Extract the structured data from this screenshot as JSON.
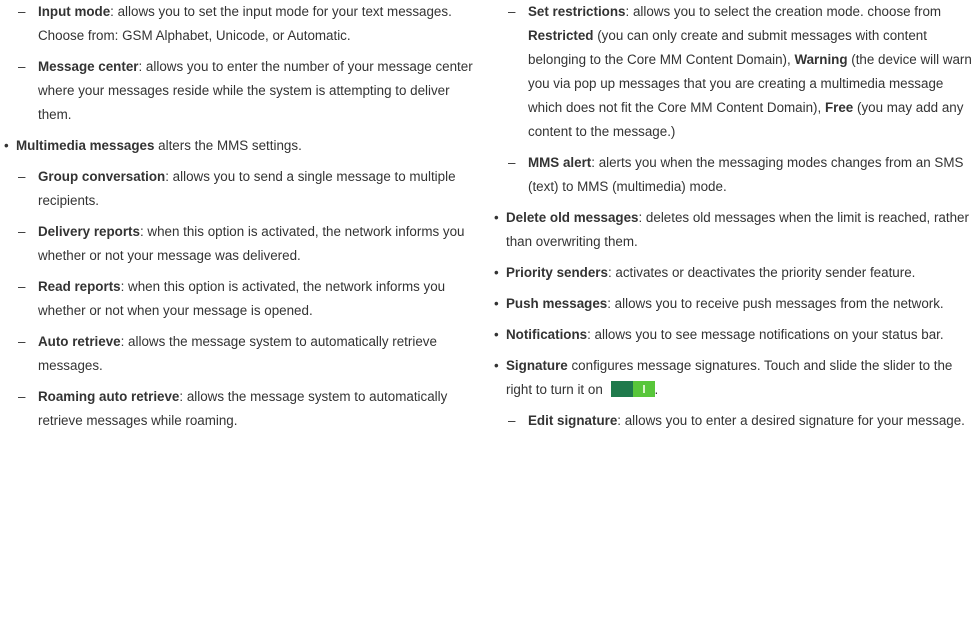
{
  "left": {
    "input_mode": {
      "dash": "–",
      "term": "Input mode",
      "text": ": allows you to set the input mode for your text messages. Choose from: GSM Alphabet, Unicode, or Automatic."
    },
    "message_center": {
      "dash": "–",
      "term": "Message center",
      "text": ": allows you to enter the number of your message center where your messages reside while the system is attempting to deliver them."
    },
    "multimedia": {
      "bullet": "•",
      "term": "Multimedia messages",
      "text": " alters the MMS settings."
    },
    "group_conversation": {
      "dash": "–",
      "term": "Group conversation",
      "text": ": allows you to send a single message to multiple recipients."
    },
    "delivery_reports": {
      "dash": "–",
      "term": "Delivery reports",
      "text": ": when this option is activated, the network informs you whether or not your message was delivered."
    },
    "read_reports": {
      "dash": "–",
      "term": "Read reports",
      "text": ": when this option is activated, the network informs you whether or not when your message is opened."
    },
    "auto_retrieve": {
      "dash": "–",
      "term": "Auto retrieve",
      "text": ": allows the message system to automatically retrieve messages."
    },
    "roaming_auto_retrieve": {
      "dash": "–",
      "term": "Roaming auto retrieve",
      "text": ": allows the message system to automatically retrieve messages while roaming."
    }
  },
  "right": {
    "set_restrictions": {
      "dash": "–",
      "term": "Set restrictions",
      "t1": ": allows you to select the creation mode. choose from ",
      "restricted": "Restricted",
      "t2": " (you can only create and submit messages with content belonging to the Core MM Content Domain), ",
      "warning": "Warning",
      "t3": " (the device will warn you via pop up messages that you are creating a multimedia message which does not fit the Core MM Content Domain), ",
      "free": "Free",
      "t4": " (you may add any content to the message.)"
    },
    "mms_alert": {
      "dash": "–",
      "term": "MMS alert",
      "text": ": alerts you when the messaging modes changes from an SMS (text) to MMS (multimedia) mode."
    },
    "delete_old": {
      "bullet": "•",
      "term": "Delete old messages",
      "text": ": deletes old messages when the limit is reached, rather than overwriting them."
    },
    "priority_senders": {
      "bullet": "•",
      "term": "Priority senders",
      "text": ": activates or deactivates the priority sender feature."
    },
    "push_messages": {
      "bullet": "•",
      "term": "Push messages",
      "text": ": allows you to receive push messages from the network."
    },
    "notifications": {
      "bullet": "•",
      "term": "Notifications",
      "text": ": allows you to see message notifications on your status bar."
    },
    "signature": {
      "bullet": "•",
      "term": "Signature",
      "text": " configures message signatures. Touch and slide the slider to the right to turn it on",
      "end": ".",
      "toggle_state": "on",
      "toggle_colors": {
        "track": "#1f7a4c",
        "knob": "#58c63a"
      }
    },
    "edit_signature": {
      "dash": "–",
      "term": "Edit signature",
      "text": ": allows you to enter a desired signature for your message."
    }
  }
}
